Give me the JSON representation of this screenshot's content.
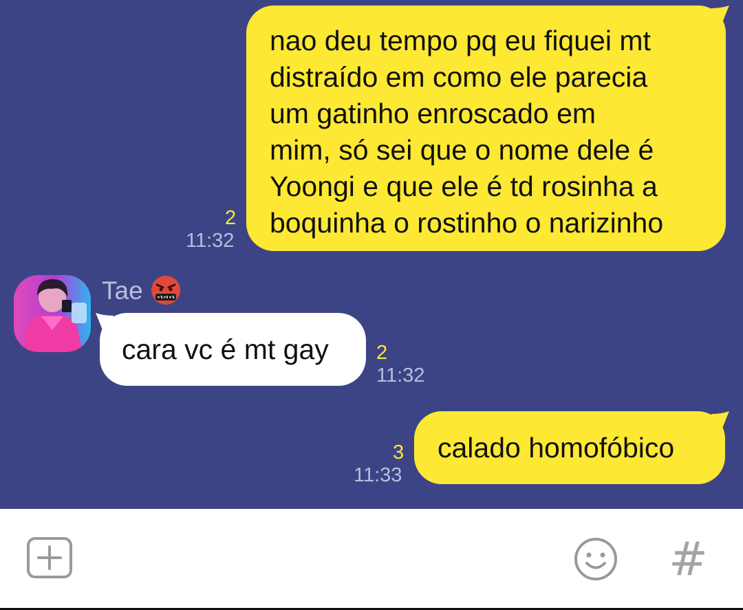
{
  "chat": {
    "messages": [
      {
        "direction": "outgoing",
        "lines": [
          "nao deu tempo pq eu fiquei mt",
          "distraído em como ele parecia",
          "um gatinho enroscado em",
          "mim, só sei que o nome dele é",
          "Yoongi e que ele é td rosinha a",
          "boquinha o rostinho o narizinho"
        ],
        "read_count": "2",
        "time": "11:32"
      },
      {
        "direction": "incoming",
        "sender": "Tae",
        "text": "cara vc é mt gay",
        "read_count": "2",
        "time": "11:32"
      },
      {
        "direction": "outgoing",
        "text": "calado homofóbico",
        "read_count": "3",
        "time": "11:33"
      }
    ]
  },
  "input_bar": {
    "add_icon": "plus-square-icon",
    "emoji_icon": "smiley-face-icon",
    "hashtag_label": "#"
  },
  "colors": {
    "chat_background": "#3d4485",
    "outgoing_bubble": "#fde834",
    "incoming_bubble": "#ffffff",
    "read_count": "#fde834",
    "timestamp": "#b9bde0"
  }
}
